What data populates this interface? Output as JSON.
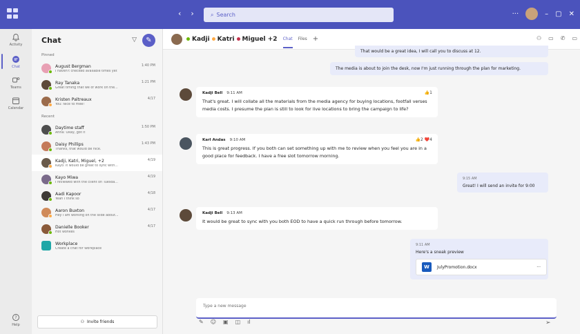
{
  "titlebar": {
    "search_placeholder": "Search",
    "back": "‹",
    "forward": "›",
    "more": "···",
    "minimize": "–",
    "maximize": "▢",
    "close": "✕"
  },
  "rail": [
    {
      "label": "Activity",
      "icon": "bell-icon"
    },
    {
      "label": "Chat",
      "icon": "chat-icon"
    },
    {
      "label": "Teams",
      "icon": "teams-icon"
    },
    {
      "label": "Calendar",
      "icon": "calendar-icon"
    },
    {
      "label": "Help",
      "icon": "help-icon"
    }
  ],
  "chatlist": {
    "title": "Chat",
    "pinned_label": "Pinned",
    "recent_label": "Recent",
    "invite_label": "Invite friends",
    "pinned": [
      {
        "name": "August Bergman",
        "preview": "I haven't checked available times yet",
        "time": "1:40 PM",
        "color": "#e8a0b4"
      },
      {
        "name": "Ray Tanaka",
        "preview": "Great timing that we of work on the...",
        "time": "1:21 PM",
        "color": "#5d4a3a"
      },
      {
        "name": "Kristen Paltreaux",
        "preview": "You: Nice to mee!",
        "time": "4/17",
        "color": "#9b6b4b"
      }
    ],
    "recent": [
      {
        "name": "Daytime staff",
        "preview": "Anna: Okay, got it",
        "time": "1:50 PM",
        "color": "#4e4e4e"
      },
      {
        "name": "Daisy Phillips",
        "preview": "Thanks, that would be nice.",
        "time": "1:43 PM",
        "color": "#c47a5a"
      },
      {
        "name": "Kadji, Katri, Miguel, +2",
        "preview": "Kayo: It would be great to sync with...",
        "time": "4/19",
        "color": "#6a5a4a"
      },
      {
        "name": "Kayo Miwa",
        "preview": "I reviewed with the client on Tuesda...",
        "time": "4/19",
        "color": "#7a6a8a"
      },
      {
        "name": "Aadi Kapoor",
        "preview": "Yeah I think so",
        "time": "4/18",
        "color": "#3e3a36"
      },
      {
        "name": "Aaron Buxton",
        "preview": "Hey I am working on the slide about...",
        "time": "4/17",
        "color": "#d08a5a"
      },
      {
        "name": "Danielle Booker",
        "preview": "Hot wonkes",
        "time": "4/17",
        "color": "#8a5a3a"
      },
      {
        "name": "Workplace",
        "preview": "Create a chat for Workplace",
        "time": "",
        "color": "#20a7a7"
      }
    ]
  },
  "channel": {
    "names": [
      "Kadji",
      "Katri",
      "Miguel +2"
    ],
    "tab_chat": "Chat",
    "tab_files": "Files",
    "add": "+"
  },
  "messages": {
    "self1": "That would be a great idea, I will call you to discuss at 12.",
    "self2": "The media is about to join the desk, now I'm just running through the plan for marketing.",
    "m1": {
      "sender": "Kadji Bell",
      "time": "9:11 AM",
      "react": "👍1",
      "body": "That's great. I will collate all the materials from the media agency for buying locations, footfall verses media costs. I presume the plan is still to look for live locations to bring the campaign to life?"
    },
    "m2": {
      "sender": "Karl Andas",
      "time": "9:10 AM",
      "react": "👍2 ❤️4",
      "body": "This is great progress. If you both can set something up with me to review when you feel you are in a good place for feedback. I have a free slot tomorrow morning."
    },
    "self3": {
      "time": "9:15 AM",
      "body": "Great! I will send an invite for 9:00"
    },
    "m3": {
      "sender": "Kadji Bell",
      "time": "9:13 AM",
      "body": "It would be great to sync with you both EOD to have a quick run through before tomorrow."
    },
    "self4": {
      "time": "9:11 AM",
      "body": "Here's a sneak preview",
      "file": "JulyPromotion.docx"
    }
  },
  "compose": {
    "placeholder": "Type a new message"
  }
}
